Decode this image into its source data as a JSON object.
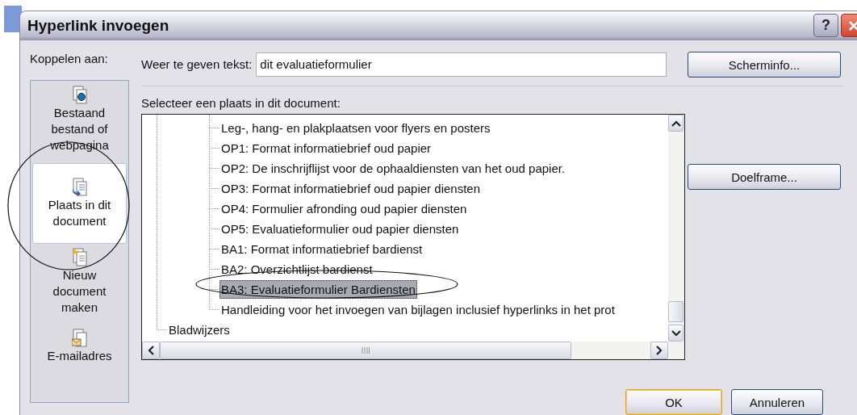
{
  "window": {
    "title": "Hyperlink invoegen"
  },
  "link_to": {
    "label": "Koppelen aan:",
    "items": [
      {
        "kind": "file",
        "label": "Bestaand bestand of webpagina",
        "selected": false
      },
      {
        "kind": "place",
        "label": "Plaats in dit document",
        "selected": true
      },
      {
        "kind": "new",
        "label": "Nieuw document maken",
        "selected": false
      },
      {
        "kind": "email",
        "label": "E-mailadres",
        "selected": false
      }
    ]
  },
  "display_text": {
    "label": "Weer te geven tekst:",
    "value": "dit evaluatieformulier"
  },
  "tree": {
    "label": "Selecteer een plaats in dit document:",
    "items": [
      {
        "children": [
          {
            "label": "Leg-, hang- en plakplaatsen voor flyers en posters",
            "selected": false
          },
          {
            "label": "OP1: Format informatiebrief oud papier",
            "selected": false
          },
          {
            "label": "OP2: De inschrijflijst voor de ophaaldiensten van het oud papier.",
            "selected": false
          },
          {
            "label": "OP3: Format informatiebrief oud papier diensten",
            "selected": false
          },
          {
            "label": "OP4: Formulier afronding oud papier diensten",
            "selected": false
          },
          {
            "label": "OP5: Evaluatieformulier oud papier diensten",
            "selected": false
          },
          {
            "label": "BA1: Format informatiebrief bardienst",
            "selected": false
          },
          {
            "label": "BA2: Overzichtlijst bardienst",
            "selected": false
          },
          {
            "label": "BA3: Evaluatieformulier Bardiensten",
            "selected": true
          },
          {
            "label": "Handleiding voor het invoegen van bijlagen inclusief hyperlinks in het prot",
            "selected": false
          }
        ]
      },
      {
        "label": "Bladwijzers",
        "selected": false
      }
    ]
  },
  "buttons": {
    "screen_tip": "Scherminfo...",
    "target_frame": "Doelframe...",
    "ok": "OK",
    "cancel": "Annuleren"
  },
  "title_buttons": {
    "help": "?"
  }
}
